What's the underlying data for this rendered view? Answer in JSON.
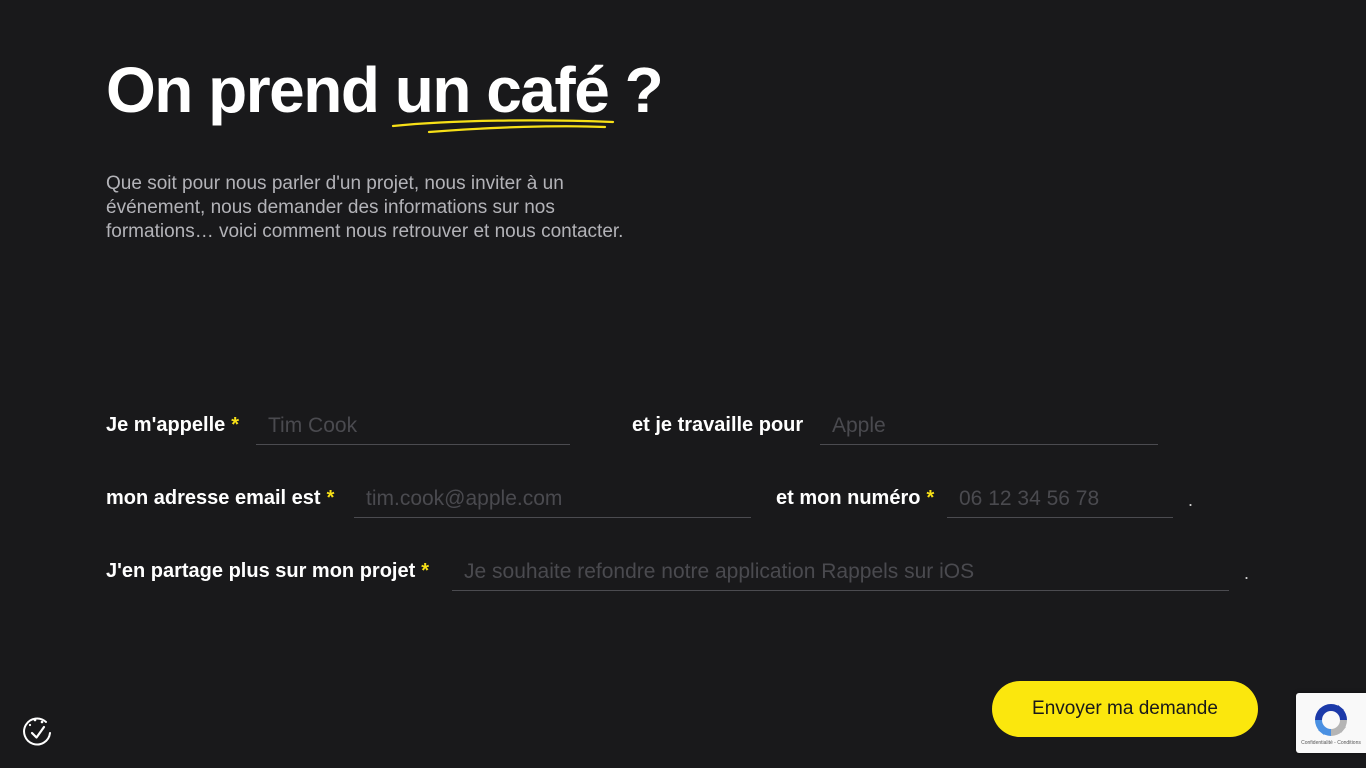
{
  "hero": {
    "title_prefix": "On prend ",
    "title_highlight": "un café",
    "title_suffix": " ?",
    "intro": "Que soit pour nous parler d'un projet, nous inviter à un événement, nous demander des informations sur nos formations… voici comment nous retrouver et nous contacter."
  },
  "form": {
    "required_mark": "*",
    "name_label": "Je m'appelle",
    "name_placeholder": "Tim Cook",
    "company_label": "et je travaille pour",
    "company_placeholder": "Apple",
    "email_label": "mon adresse email est",
    "email_placeholder": "tim.cook@apple.com",
    "phone_label": "et mon numéro",
    "phone_placeholder": "06 12 34 56 78",
    "project_label": "J'en partage plus sur mon projet",
    "project_placeholder": "Je souhaite refondre notre application Rappels sur iOS",
    "end_dot": ".",
    "submit_label": "Envoyer ma demande"
  },
  "recaptcha": {
    "links": "Confidentialité - Conditions"
  },
  "colors": {
    "background": "#19191b",
    "accent": "#fbe70d",
    "required": "#f7e017"
  },
  "icons": {
    "cookie_settings": "cookie-check-icon",
    "recaptcha": "recaptcha-logo-icon"
  }
}
